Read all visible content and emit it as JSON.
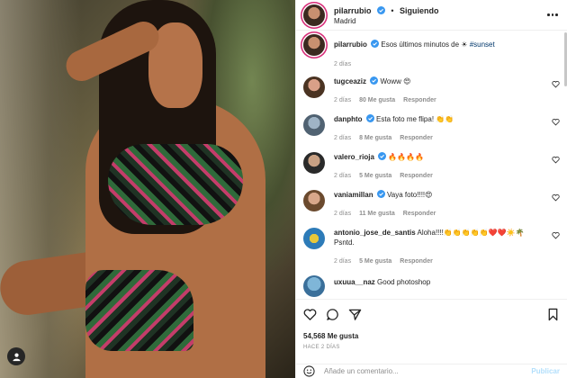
{
  "header": {
    "username": "pilarrubio",
    "separator": "•",
    "follow_label": "Siguiendo",
    "location": "Madrid"
  },
  "caption": {
    "username": "pilarrubio",
    "text": "Esos últimos minutos de ☀ ",
    "hashtag": "#sunset",
    "time": "2 días"
  },
  "comments": [
    {
      "username": "tugceaziz",
      "verified": true,
      "text": "Woww 😍",
      "time": "2 días",
      "likes": "80 Me gusta",
      "reply": "Responder"
    },
    {
      "username": "danphto",
      "verified": true,
      "text": "Esta foto me flipa! 👏👏",
      "time": "2 días",
      "likes": "8 Me gusta",
      "reply": "Responder"
    },
    {
      "username": "valero_rioja",
      "verified": true,
      "text": "🔥🔥🔥🔥",
      "time": "2 días",
      "likes": "5 Me gusta",
      "reply": "Responder"
    },
    {
      "username": "vaniamillan",
      "verified": true,
      "text": "Vaya foto!!!!😍",
      "time": "2 días",
      "likes": "11 Me gusta",
      "reply": "Responder"
    },
    {
      "username": "antonio_jose_de_santis",
      "verified": false,
      "text": "Aloha!!!!👏👏👏👏👏❤️❤️☀️🌴 Psntd.",
      "time": "2 días",
      "likes": "5 Me gusta",
      "reply": "Responder"
    },
    {
      "username": "uxuua__naz",
      "verified": false,
      "text": "Good photoshop",
      "time": "",
      "likes": "",
      "reply": ""
    }
  ],
  "actions": {
    "likes_count": "54,568 Me gusta",
    "posted_ago": "HACE 2 DÍAS"
  },
  "add_comment": {
    "placeholder": "Añade un comentario...",
    "publish_label": "Publicar"
  },
  "colors": {
    "verified": "#3897f0",
    "link": "#00376b",
    "muted": "#8e8e8e",
    "publish_disabled": "#b2dffc"
  }
}
